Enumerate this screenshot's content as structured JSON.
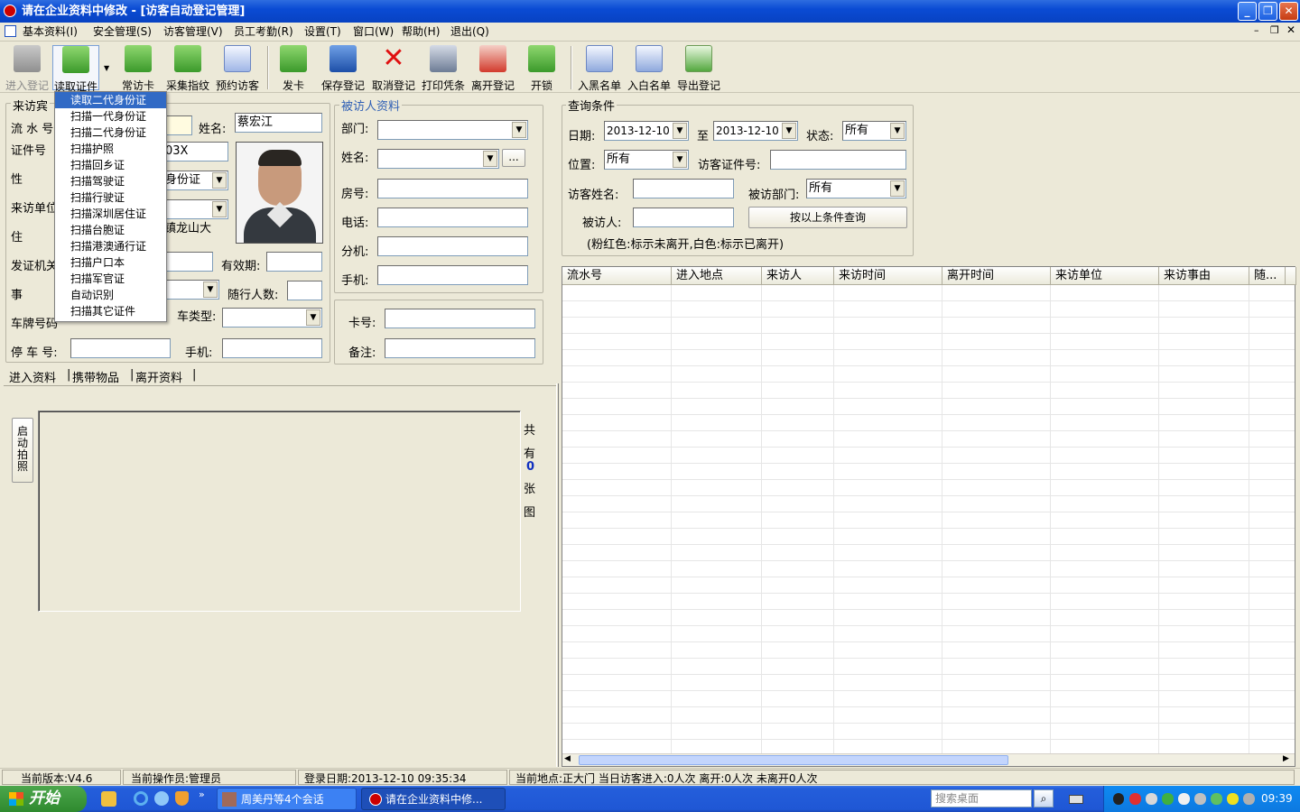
{
  "window": {
    "title": "请在企业资料中修改 - [访客自动登记管理]"
  },
  "menu": [
    "基本资料(I)",
    "安全管理(S)",
    "访客管理(V)",
    "员工考勤(R)",
    "设置(T)",
    "窗口(W)",
    "帮助(H)",
    "退出(Q)"
  ],
  "toolbar": {
    "enter": "进入登记",
    "read_id": "读取证件",
    "regular": "常访卡",
    "finger": "采集指纹",
    "reserve": "预约访客",
    "issue": "发卡",
    "save": "保存登记",
    "cancel": "取消登记",
    "print": "打印凭条",
    "leave": "离开登记",
    "unlock": "开锁",
    "blacklist": "入黑名单",
    "whitelist": "入白名单",
    "export": "导出登记"
  },
  "dropdown": [
    "读取二代身份证",
    "扫描一代身份证",
    "扫描二代身份证",
    "扫描护照",
    "扫描回乡证",
    "扫描驾驶证",
    "扫描行驶证",
    "扫描深圳居住证",
    "扫描台胞证",
    "扫描港澳通行证",
    "扫描户口本",
    "扫描军官证",
    "自动识别",
    "扫描其它证件"
  ],
  "visitor": {
    "group_label": "来访宾",
    "serial_label": "流 水 号",
    "name_label": "姓名:",
    "name_value": "蔡宏江",
    "id_label": "证件号",
    "id_value": "03X",
    "gender_label": "性",
    "id_type_value": "身份证",
    "unit_label": "来访单位",
    "address_label": "住",
    "address_value": "镇龙山大",
    "issuer_label": "发证机关",
    "valid_label": "有效期:",
    "reason_label": "事",
    "companions_label": "随行人数:",
    "plate_label": "车牌号码",
    "car_type_label": "车类型:",
    "parking_label": "停 车 号:",
    "mobile_label": "手机:"
  },
  "host": {
    "group_label": "被访人资料",
    "dept": "部门:",
    "name": "姓名:",
    "room": "房号:",
    "phone": "电话:",
    "ext": "分机:",
    "mobile": "手机:",
    "browse": "...",
    "card": "卡号:",
    "remark": "备注:"
  },
  "tabs": [
    "进入资料",
    "携带物品",
    "离开资料"
  ],
  "photo": {
    "start_button": "启动拍照",
    "count_text": [
      "共",
      "有",
      "0",
      "张",
      "图"
    ]
  },
  "query": {
    "group_label": "查询条件",
    "date_label": "日期:",
    "date_from": "2013-12-10",
    "to_label": "至",
    "date_to": "2013-12-10",
    "status_label": "状态:",
    "status_value": "所有",
    "location_label": "位置:",
    "location_value": "所有",
    "id_label": "访客证件号:",
    "vname_label": "访客姓名:",
    "dept_label": "被访部门:",
    "dept_value": "所有",
    "host_label": "被访人:",
    "search_button": "按以上条件查询",
    "hint": "(粉红色:标示未离开,白色:标示已离开)"
  },
  "grid": {
    "columns": [
      "流水号",
      "进入地点",
      "来访人",
      "来访时间",
      "离开时间",
      "来访单位",
      "来访事由",
      "随..."
    ]
  },
  "status": {
    "version": "当前版本:V4.6",
    "operator": "当前操作员:管理员",
    "login": "登录日期:2013-12-10 09:35:34",
    "location": "当前地点:正大门  当日访客进入:0人次  离开:0人次  未离开0人次"
  },
  "taskbar": {
    "start": "开始",
    "task1": "周美丹等4个会话",
    "task2": "请在企业资料中修...",
    "search_placeholder": "搜索桌面",
    "time": "09:39"
  }
}
